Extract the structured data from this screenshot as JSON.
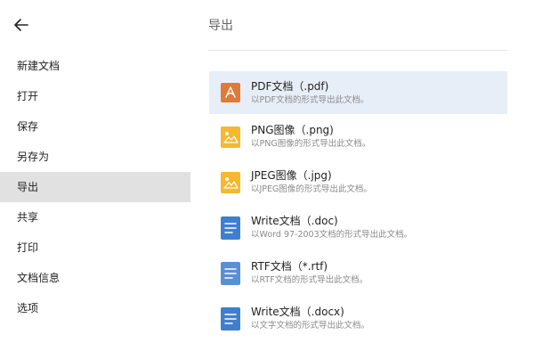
{
  "sidebar": {
    "back_icon": "arrow-left-icon",
    "items": [
      {
        "label": "新建文档"
      },
      {
        "label": "打开"
      },
      {
        "label": "保存"
      },
      {
        "label": "另存为"
      },
      {
        "label": "导出"
      },
      {
        "label": "共享"
      },
      {
        "label": "打印"
      },
      {
        "label": "文档信息"
      },
      {
        "label": "选项"
      }
    ],
    "active_index": 4
  },
  "main": {
    "title": "导出",
    "items": [
      {
        "name": "PDF文档（.pdf)",
        "desc": "以PDF文档的形式导出此文档。",
        "icon": "pdf-icon",
        "color": "#e07a3a"
      },
      {
        "name": "PNG图像（.png)",
        "desc": "以PNG图像的形式导出此文档。",
        "icon": "image-icon",
        "color": "#f5b82e"
      },
      {
        "name": "JPEG图像（.jpg)",
        "desc": "以JPEG图像的形式导出此文档。",
        "icon": "image-icon",
        "color": "#f5b82e"
      },
      {
        "name": "Write文档（.doc)",
        "desc": "以Word 97-2003文档的形式导出此文档。",
        "icon": "document-icon",
        "color": "#3f7fd0"
      },
      {
        "name": "RTF文档（*.rtf)",
        "desc": "以RTF文档的形式导出此文档。",
        "icon": "document-icon",
        "color": "#5a8fd6"
      },
      {
        "name": "Write文档（.docx)",
        "desc": "以文字文档的形式导出此文档。",
        "icon": "document-icon",
        "color": "#3f7fd0"
      }
    ],
    "selected_index": 0,
    "selected_color": "#e8eef8"
  }
}
